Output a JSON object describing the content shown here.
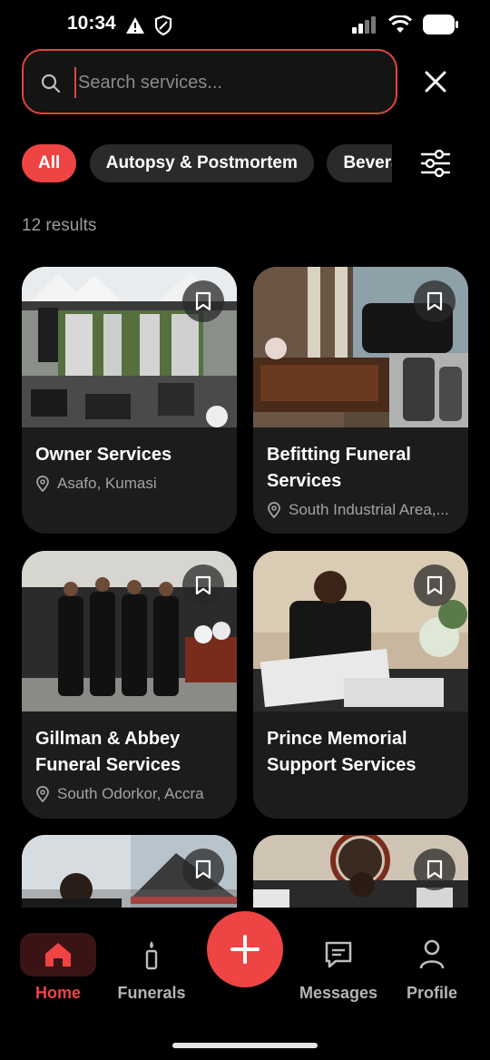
{
  "status": {
    "time": "10:34"
  },
  "search": {
    "placeholder": "Search services...",
    "value": ""
  },
  "filters": {
    "chips": [
      {
        "label": "All",
        "active": true
      },
      {
        "label": "Autopsy & Postmortem",
        "active": false
      },
      {
        "label": "Beverages",
        "active": false
      }
    ]
  },
  "results": {
    "count_label": "12 results"
  },
  "services": [
    {
      "title": "Owner Services",
      "location": "Asafo, Kumasi"
    },
    {
      "title": "Befitting Funeral Services",
      "location": "South Industrial Area,..."
    },
    {
      "title": "Gillman & Abbey Funeral Services",
      "location": "South Odorkor, Accra"
    },
    {
      "title": "Prince Memorial Support Services",
      "location": ""
    },
    {
      "title": "",
      "location": ""
    },
    {
      "title": "",
      "location": ""
    }
  ],
  "nav": {
    "home": "Home",
    "funerals": "Funerals",
    "messages": "Messages",
    "profile": "Profile"
  },
  "colors": {
    "accent": "#ef4444",
    "background": "#000000",
    "card": "#1c1c1c",
    "chip": "#2a2a2a"
  },
  "icons": [
    "search-icon",
    "close-icon",
    "filter-sliders-icon",
    "bookmark-icon",
    "location-pin-icon",
    "home-icon",
    "candle-icon",
    "plus-icon",
    "message-icon",
    "person-icon"
  ]
}
